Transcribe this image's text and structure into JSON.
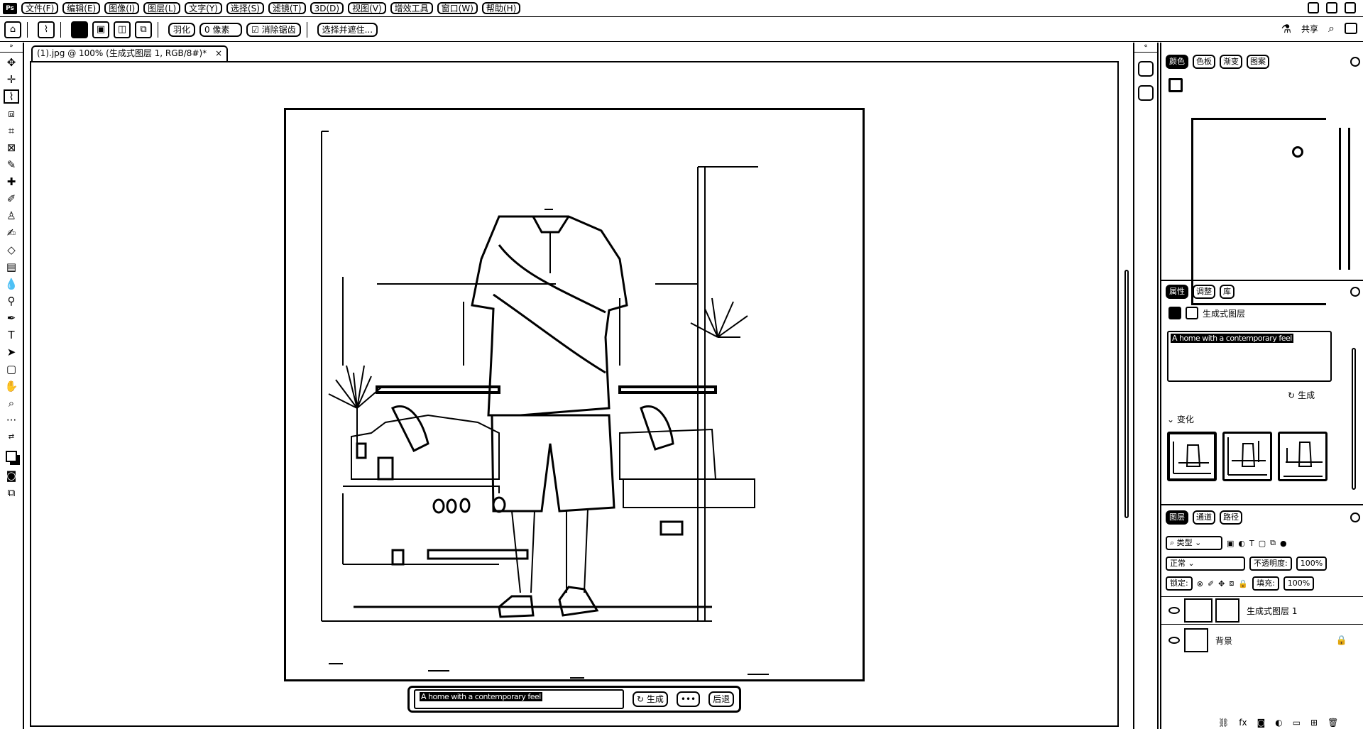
{
  "menubar": {
    "app_logo": "Ps",
    "items": [
      "文件(F)",
      "编辑(E)",
      "图像(I)",
      "图层(L)",
      "文字(Y)",
      "选择(S)",
      "滤镜(T)",
      "3D(D)",
      "视图(V)",
      "增效工具",
      "窗口(W)",
      "帮助(H)"
    ]
  },
  "options": {
    "feather_label": "羽化",
    "feather_value": "0 像素",
    "antialias_label": "消除锯齿",
    "select_mask_label": "选择并遮住...",
    "share_label": "共享"
  },
  "document": {
    "tab_title": "(1).jpg @ 100% (生成式图层 1, RGB/8#)",
    "tab_modified": "*",
    "close_glyph": "×"
  },
  "taskbar": {
    "prompt": "A home with a contemporary feel",
    "generate_label": "生成",
    "more_label": "•••",
    "undo_label": "后退"
  },
  "panels": {
    "top_tabs": [
      "颜色",
      "色板",
      "渐变",
      "图案"
    ],
    "props_tabs": [
      "属性",
      "调整",
      "库"
    ],
    "props_layer_type": "生成式图层",
    "props_prompt": "A home with a contemporary feel",
    "props_generate": "生成",
    "variations_label": "变化",
    "layers_tabs": [
      "图层",
      "通道",
      "路径"
    ],
    "filter_kind": "类型",
    "blend_mode": "正常",
    "opacity_label": "不透明度:",
    "opacity_value": "100%",
    "lock_label": "锁定:",
    "fill_label": "填充:",
    "fill_value": "100%",
    "layers": [
      {
        "name": "生成式图层 1"
      },
      {
        "name": "背景"
      }
    ]
  }
}
